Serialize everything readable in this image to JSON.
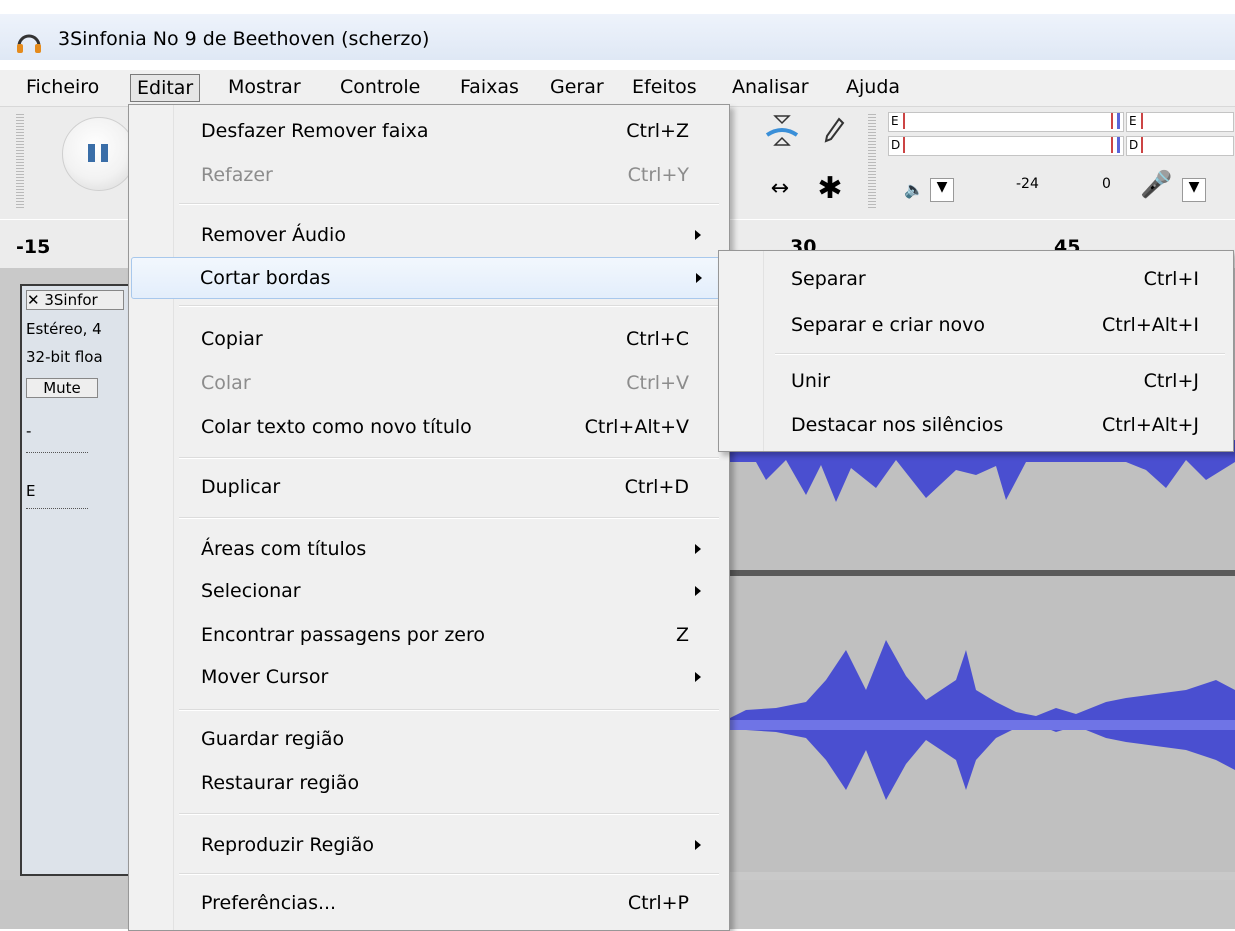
{
  "window": {
    "title": "3Sinfonia No 9 de Beethoven (scherzo)",
    "app_icon": "headphones-icon"
  },
  "menubar": {
    "items": [
      "Ficheiro",
      "Editar",
      "Mostrar",
      "Controle",
      "Faixas",
      "Gerar",
      "Efeitos",
      "Analisar",
      "Ajuda"
    ],
    "active": "Editar"
  },
  "toolbar": {
    "meter_left": "E",
    "meter_right": "D",
    "db_label": "-24",
    "zero_label": "0"
  },
  "ruler": {
    "labels": [
      "-15",
      "30",
      "45"
    ]
  },
  "track": {
    "name": "3Sinfor",
    "info1": "Estéreo, 4",
    "info2": "32-bit floa",
    "mute": "Mute",
    "gain_minus": "-",
    "pan_left": "E"
  },
  "edit_menu": {
    "items": [
      {
        "label": "Desfazer Remover faixa",
        "shortcut": "Ctrl+Z"
      },
      {
        "label": "Refazer",
        "shortcut": "Ctrl+Y",
        "disabled": true
      },
      {
        "label": "Remover Áudio",
        "submenu": true
      },
      {
        "label": "Cortar bordas",
        "submenu": true,
        "highlighted": true
      },
      {
        "label": "Copiar",
        "shortcut": "Ctrl+C"
      },
      {
        "label": "Colar",
        "shortcut": "Ctrl+V",
        "disabled": true
      },
      {
        "label": "Colar texto como novo título",
        "shortcut": "Ctrl+Alt+V"
      },
      {
        "label": "Duplicar",
        "shortcut": "Ctrl+D"
      },
      {
        "label": "Áreas com títulos",
        "submenu": true
      },
      {
        "label": "Selecionar",
        "submenu": true
      },
      {
        "label": "Encontrar passagens por zero",
        "shortcut": "Z"
      },
      {
        "label": "Mover Cursor",
        "submenu": true
      },
      {
        "label": "Guardar região"
      },
      {
        "label": "Restaurar região"
      },
      {
        "label": "Reproduzir Região",
        "submenu": true
      },
      {
        "label": "Preferências...",
        "shortcut": "Ctrl+P"
      }
    ]
  },
  "submenu": {
    "items": [
      {
        "label": "Separar",
        "shortcut": "Ctrl+I"
      },
      {
        "label": "Separar e criar novo",
        "shortcut": "Ctrl+Alt+I"
      },
      {
        "label": "Unir",
        "shortcut": "Ctrl+J"
      },
      {
        "label": "Destacar nos silêncios",
        "shortcut": "Ctrl+Alt+J"
      }
    ]
  },
  "colors": {
    "waveform": "#4a4fd0",
    "highlight": "#e3eefb",
    "accent": "#3a6ea8"
  }
}
